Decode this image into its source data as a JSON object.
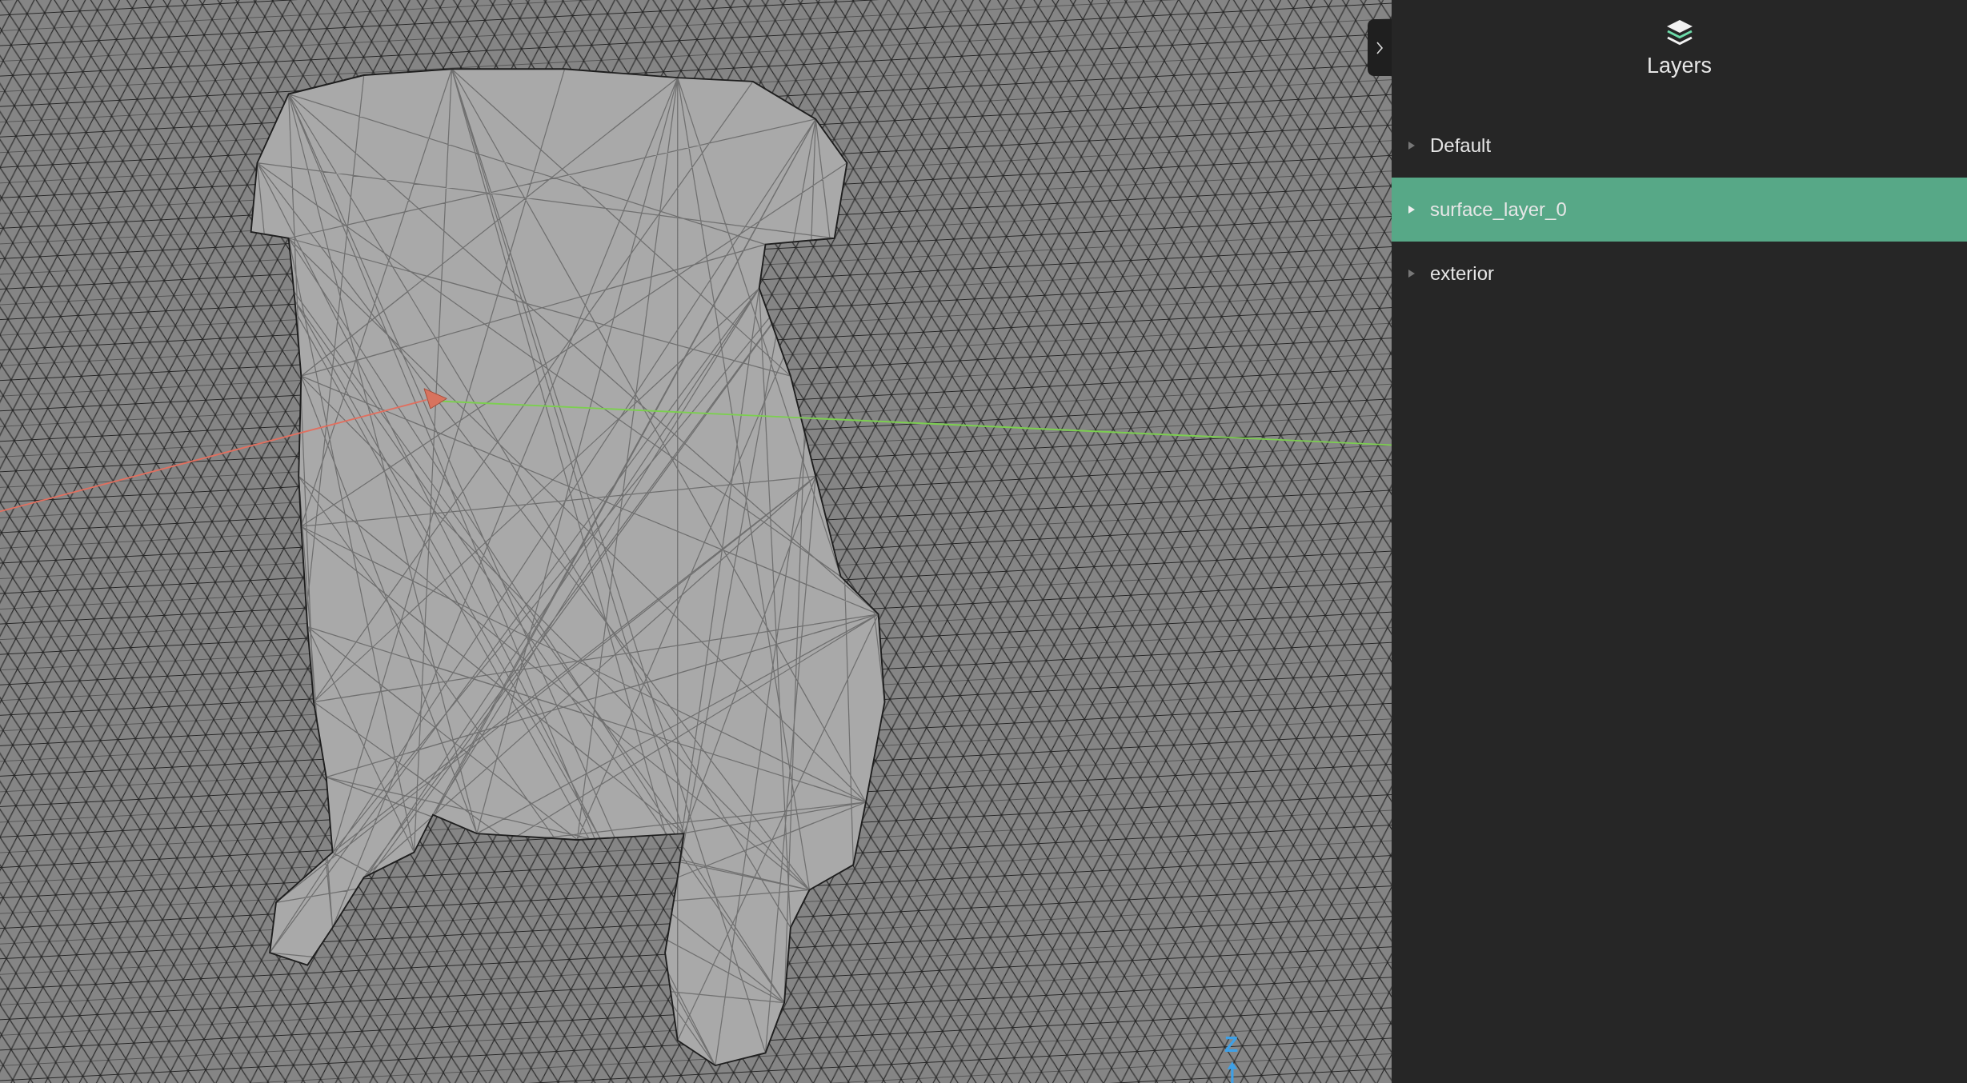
{
  "viewport": {
    "axis_label": "Z"
  },
  "panel": {
    "title": "Layers"
  },
  "layers": [
    {
      "name": "Default",
      "selected": false,
      "expanded": false
    },
    {
      "name": "surface_layer_0",
      "selected": true,
      "expanded": false
    },
    {
      "name": "exterior",
      "selected": false,
      "expanded": false
    }
  ]
}
